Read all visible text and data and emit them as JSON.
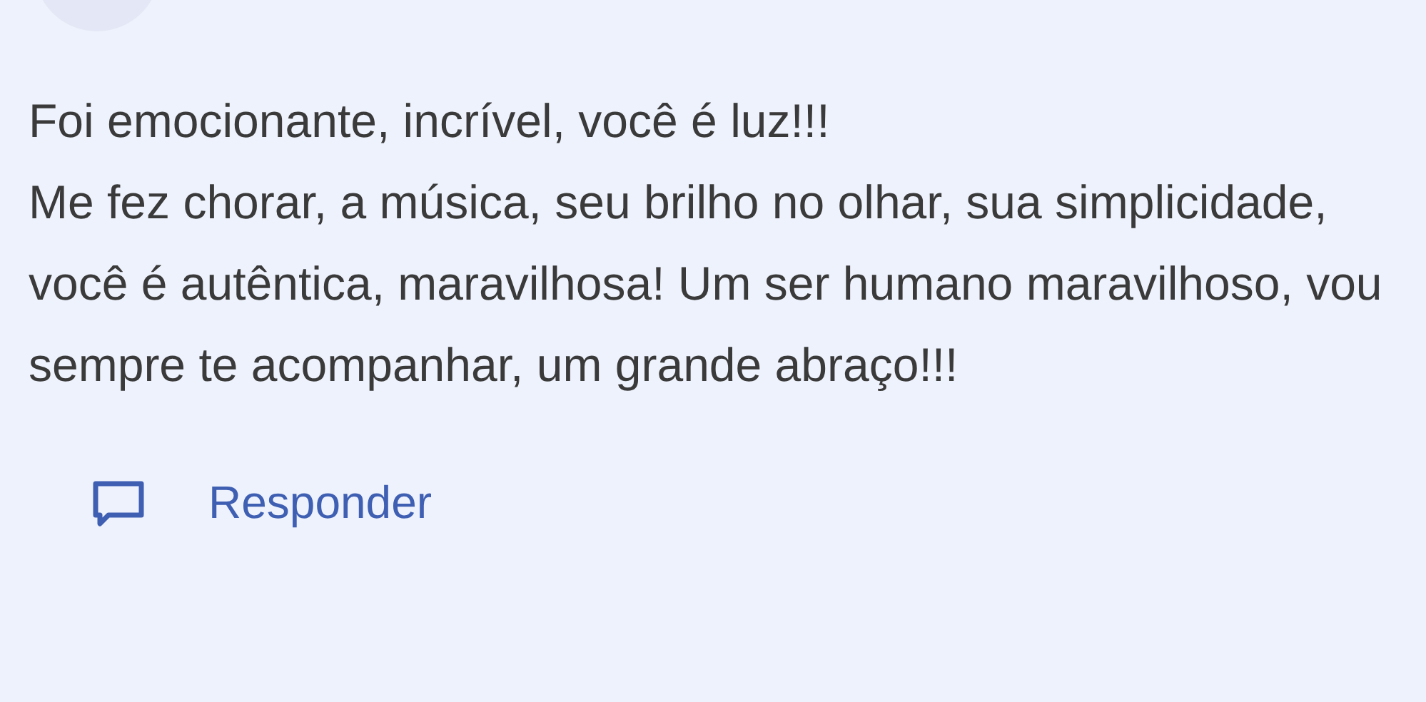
{
  "comment": {
    "text": "Foi emocionante, incrível, você é luz!!!\nMe fez chorar, a música, seu brilho no olhar, sua simplicidade, você é autêntica, maravilhosa! Um ser humano maravilhoso, vou sempre te acompanhar, um grande abraço!!!"
  },
  "reply_button": {
    "label": "Responder"
  }
}
